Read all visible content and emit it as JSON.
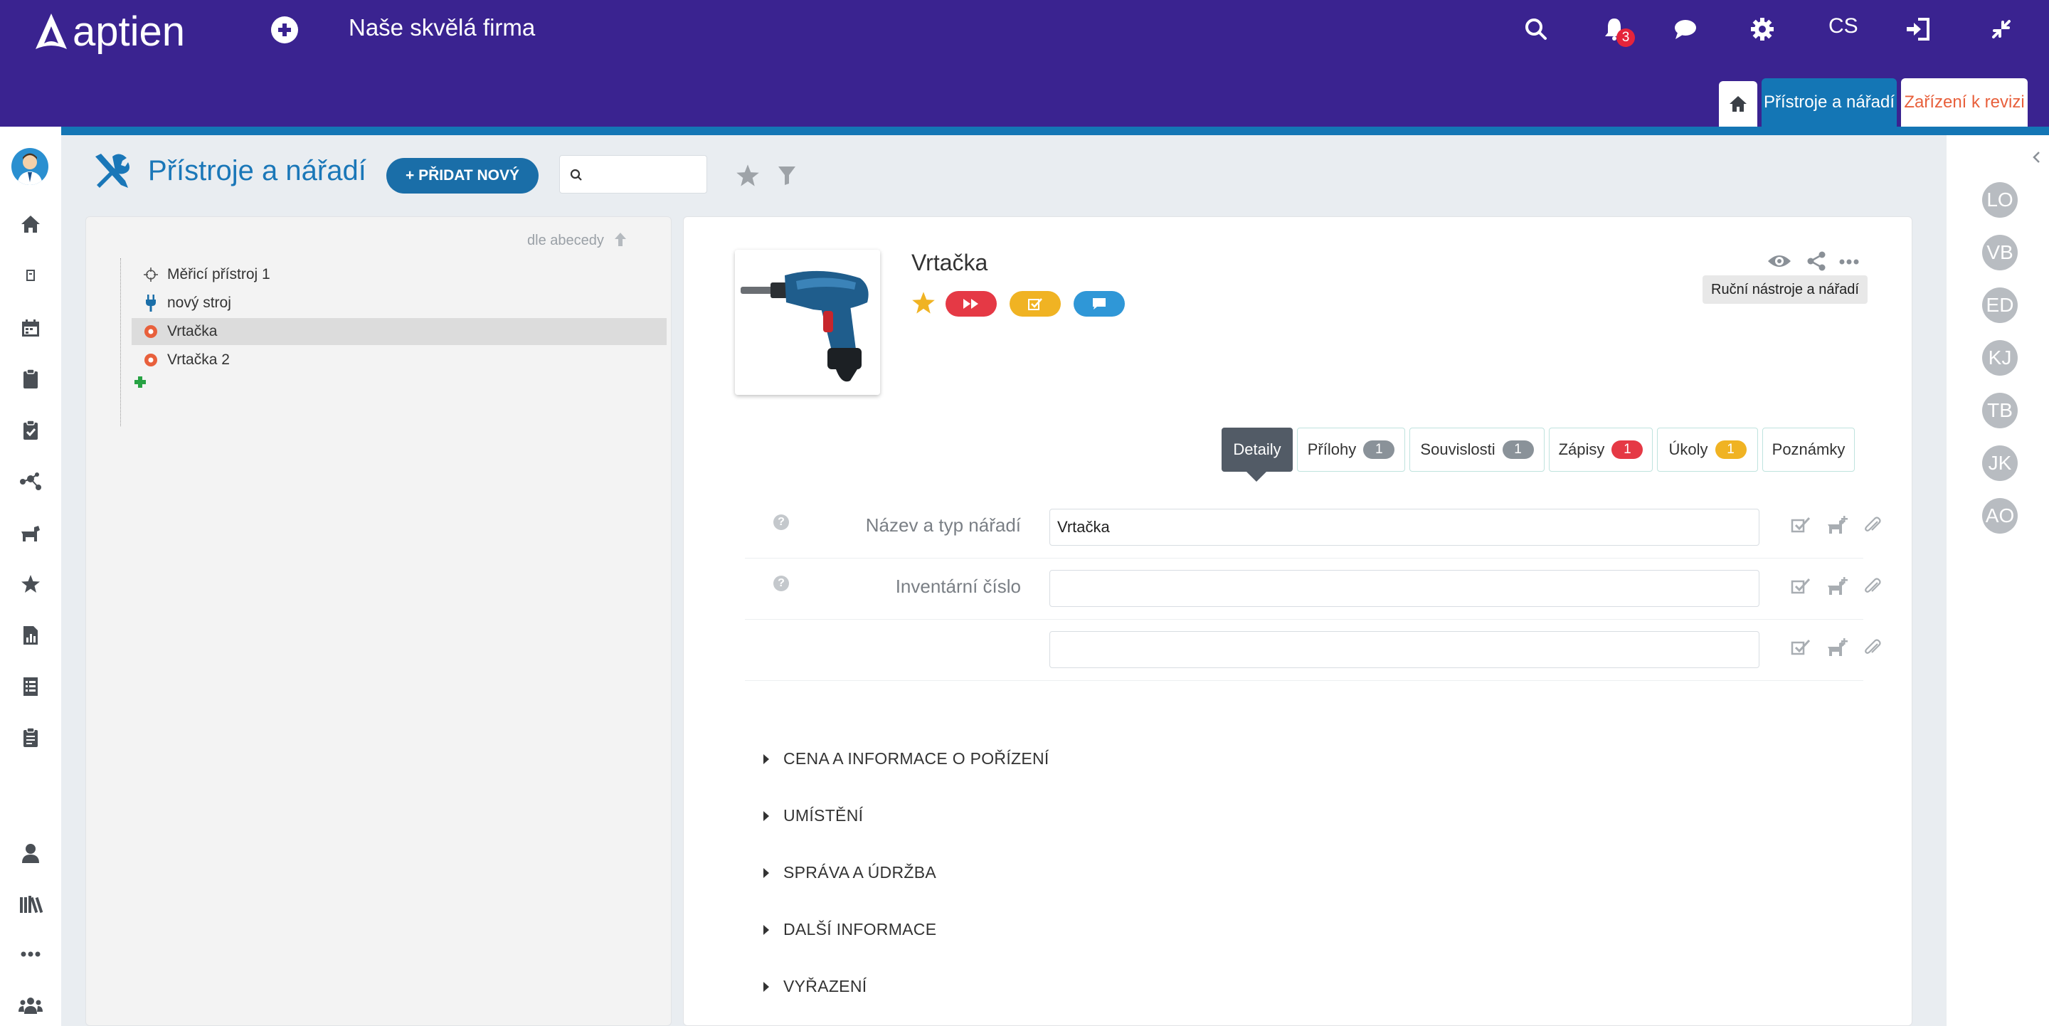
{
  "header": {
    "logo_text": "aptien",
    "company": "Naše skvělá firma",
    "notifications_count": "3",
    "language": "CS",
    "tabs": [
      {
        "label": "Přístroje a nářadí"
      },
      {
        "label": "Zařízení k revizi"
      }
    ]
  },
  "page": {
    "title": "Přístroje a nářadí",
    "add_button": "+ PŘIDAT NOVÝ",
    "search_placeholder": ""
  },
  "tree": {
    "sort_label": "dle abecedy",
    "items": [
      {
        "label": "Měřicí přístroj 1",
        "icon": "crosshair-icon"
      },
      {
        "label": "nový stroj",
        "icon": "plug-icon"
      },
      {
        "label": "Vrtačka",
        "icon": "orange-dot-icon",
        "selected": true
      },
      {
        "label": "Vrtačka 2",
        "icon": "orange-dot-icon"
      }
    ]
  },
  "detail": {
    "name": "Vrtačka",
    "category": "Ruční nástroje a nářadí",
    "tabs": [
      {
        "label": "Detaily"
      },
      {
        "label": "Přílohy",
        "count": "1",
        "color": "#8a9299"
      },
      {
        "label": "Souvislosti",
        "count": "1",
        "color": "#8a9299"
      },
      {
        "label": "Zápisy",
        "count": "1",
        "color": "#e53945"
      },
      {
        "label": "Úkoly",
        "count": "1",
        "color": "#f0b323"
      },
      {
        "label": "Poznámky"
      }
    ],
    "fields": [
      {
        "label": "Název a typ nářadí",
        "value": "Vrtačka"
      },
      {
        "label": "Inventární číslo",
        "value": ""
      },
      {
        "label": "",
        "value": ""
      }
    ],
    "sections": [
      "CENA A INFORMACE O POŘÍZENÍ",
      "UMÍSTĚNÍ",
      "SPRÁVA A ÚDRŽBA",
      "DALŠÍ INFORMACE",
      "VYŘAZENÍ"
    ]
  },
  "users": [
    "LO",
    "VB",
    "ED",
    "KJ",
    "TB",
    "JK",
    "AO"
  ],
  "colors": {
    "header_bg": "#3a2390",
    "accent_blue": "#1476b5",
    "red": "#e53945",
    "yellow": "#f0b323",
    "light_blue": "#2a8fd0"
  }
}
